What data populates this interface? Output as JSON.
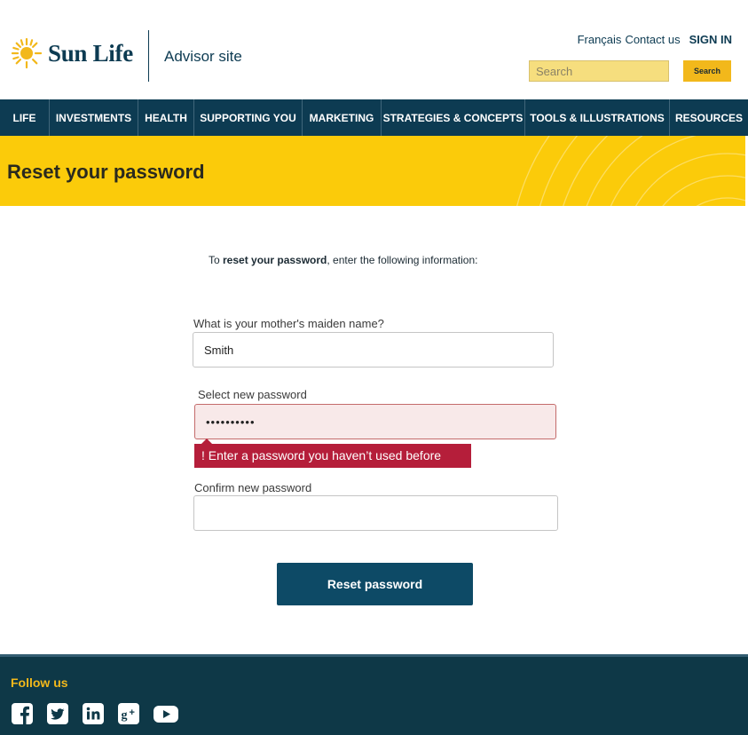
{
  "header": {
    "brand": "Sun Life",
    "site_name": "Advisor site",
    "links": {
      "language": "Français",
      "contact": "Contact us",
      "signin": "SIGN IN"
    },
    "search": {
      "placeholder": "Search",
      "button_label": "Search"
    }
  },
  "nav": {
    "items": [
      {
        "label": "LIFE"
      },
      {
        "label": "INVESTMENTS"
      },
      {
        "label": "HEALTH"
      },
      {
        "label": "SUPPORTING YOU"
      },
      {
        "label": "MARKETING"
      },
      {
        "label": "STRATEGIES & CONCEPTS"
      },
      {
        "label": "TOOLS & ILLUSTRATIONS"
      },
      {
        "label": "RESOURCES"
      }
    ]
  },
  "banner": {
    "title": "Reset your password"
  },
  "form": {
    "intro_prefix": "To ",
    "intro_bold": "reset your password",
    "intro_suffix": ", enter the following information:",
    "maiden": {
      "label": "What is your mother's maiden name?",
      "value": "Smith"
    },
    "new_password": {
      "label": "Select new password",
      "value": "••••••••••",
      "error": "! Enter a password you haven’t used before"
    },
    "confirm_password": {
      "label": "Confirm new password",
      "value": ""
    },
    "submit_label": "Reset password"
  },
  "footer": {
    "follow_label": "Follow us",
    "social": [
      "facebook-icon",
      "twitter-icon",
      "linkedin-icon",
      "google-plus-icon",
      "youtube-icon"
    ]
  },
  "colors": {
    "navy": "#0d3b52",
    "yellow": "#fbcb0a",
    "accent": "#f2b81b",
    "error": "#b51e3a"
  }
}
